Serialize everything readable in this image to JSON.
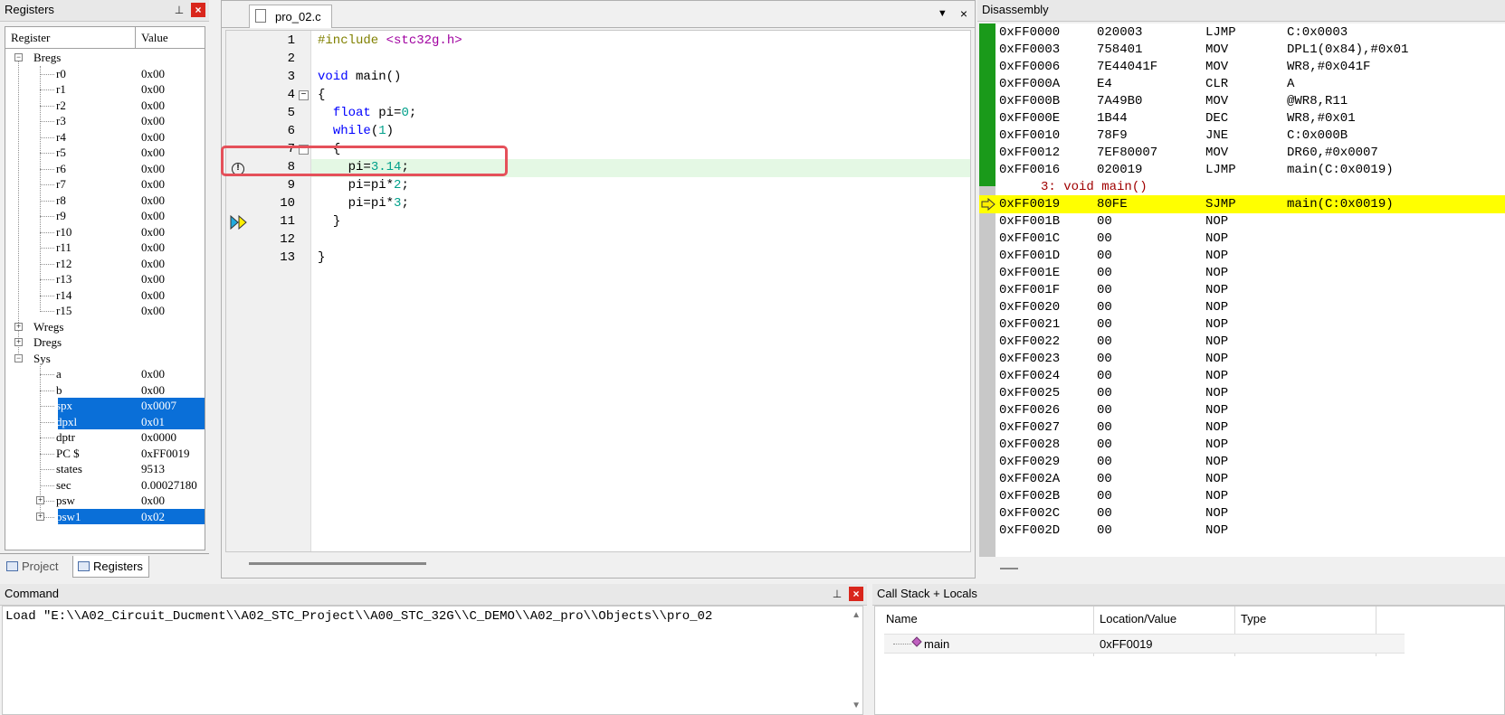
{
  "registers": {
    "title": "Registers",
    "headers": {
      "register": "Register",
      "value": "Value"
    },
    "groups": {
      "bregs": "Bregs",
      "wregs": "Wregs",
      "dregs": "Dregs",
      "sys": "Sys"
    },
    "bregs": [
      {
        "name": "r0",
        "value": "0x00"
      },
      {
        "name": "r1",
        "value": "0x00"
      },
      {
        "name": "r2",
        "value": "0x00"
      },
      {
        "name": "r3",
        "value": "0x00"
      },
      {
        "name": "r4",
        "value": "0x00"
      },
      {
        "name": "r5",
        "value": "0x00"
      },
      {
        "name": "r6",
        "value": "0x00"
      },
      {
        "name": "r7",
        "value": "0x00"
      },
      {
        "name": "r8",
        "value": "0x00"
      },
      {
        "name": "r9",
        "value": "0x00"
      },
      {
        "name": "r10",
        "value": "0x00"
      },
      {
        "name": "r11",
        "value": "0x00"
      },
      {
        "name": "r12",
        "value": "0x00"
      },
      {
        "name": "r13",
        "value": "0x00"
      },
      {
        "name": "r14",
        "value": "0x00"
      },
      {
        "name": "r15",
        "value": "0x00"
      }
    ],
    "sys": [
      {
        "name": "a",
        "value": "0x00"
      },
      {
        "name": "b",
        "value": "0x00"
      },
      {
        "name": "spx",
        "value": "0x0007"
      },
      {
        "name": "dpxl",
        "value": "0x01"
      },
      {
        "name": "dptr",
        "value": "0x0000"
      },
      {
        "name": "PC  $",
        "value": "0xFF0019"
      },
      {
        "name": "states",
        "value": "9513"
      },
      {
        "name": "sec",
        "value": "0.00027180"
      },
      {
        "name": "psw",
        "value": "0x00"
      },
      {
        "name": "psw1",
        "value": "0x02"
      }
    ],
    "tabs": {
      "project": "Project",
      "registers": "Registers"
    }
  },
  "editor": {
    "tab": "pro_02.c",
    "lines": [
      "1",
      "2",
      "3",
      "4",
      "5",
      "6",
      "7",
      "8",
      "9",
      "10",
      "11",
      "12",
      "13"
    ],
    "code": {
      "l1a": "#include ",
      "l1b": "<stc32g.h>",
      "l3a": "void",
      "l3b": " main()",
      "l4": "{",
      "l5a": "float",
      "l5b": " pi=",
      "l5c": "0",
      "l5d": ";",
      "l6a": "while",
      "l6b": "(",
      "l6c": "1",
      "l6d": ")",
      "l7": "{",
      "l8a": "pi=",
      "l8b": "3.14",
      "l8c": ";",
      "l9a": "pi=pi*",
      "l9b": "2",
      "l9c": ";",
      "l10a": "pi=pi*",
      "l10b": "3",
      "l10c": ";",
      "l11": "}",
      "l13": "}"
    },
    "breakpoint_glyph": "!"
  },
  "disassembly": {
    "title": "Disassembly",
    "rows": [
      {
        "addr": "0xFF0000",
        "op": "020003",
        "mn": "LJMP",
        "arg": "C:0x0003"
      },
      {
        "addr": "0xFF0003",
        "op": "758401",
        "mn": "MOV",
        "arg": "DPL1(0x84),#0x01"
      },
      {
        "addr": "0xFF0006",
        "op": "7E44041F",
        "mn": "MOV",
        "arg": "WR8,#0x041F"
      },
      {
        "addr": "0xFF000A",
        "op": "E4",
        "mn": "CLR",
        "arg": "A"
      },
      {
        "addr": "0xFF000B",
        "op": "7A49B0",
        "mn": "MOV",
        "arg": "@WR8,R11"
      },
      {
        "addr": "0xFF000E",
        "op": "1B44",
        "mn": "DEC",
        "arg": "WR8,#0x01"
      },
      {
        "addr": "0xFF0010",
        "op": "78F9",
        "mn": "JNE",
        "arg": "C:0x000B"
      },
      {
        "addr": "0xFF0012",
        "op": "7EF80007",
        "mn": "MOV",
        "arg": "DR60,#0x0007"
      },
      {
        "addr": "0xFF0016",
        "op": "020019",
        "mn": "LJMP",
        "arg": "main(C:0x0019)"
      }
    ],
    "source_line": "3: void main()",
    "pc_row": {
      "addr": "0xFF0019",
      "op": "80FE",
      "mn": "SJMP",
      "arg": "main(C:0x0019)"
    },
    "nop_rows": [
      {
        "addr": "0xFF001B",
        "op": "00",
        "mn": "NOP"
      },
      {
        "addr": "0xFF001C",
        "op": "00",
        "mn": "NOP"
      },
      {
        "addr": "0xFF001D",
        "op": "00",
        "mn": "NOP"
      },
      {
        "addr": "0xFF001E",
        "op": "00",
        "mn": "NOP"
      },
      {
        "addr": "0xFF001F",
        "op": "00",
        "mn": "NOP"
      },
      {
        "addr": "0xFF0020",
        "op": "00",
        "mn": "NOP"
      },
      {
        "addr": "0xFF0021",
        "op": "00",
        "mn": "NOP"
      },
      {
        "addr": "0xFF0022",
        "op": "00",
        "mn": "NOP"
      },
      {
        "addr": "0xFF0023",
        "op": "00",
        "mn": "NOP"
      },
      {
        "addr": "0xFF0024",
        "op": "00",
        "mn": "NOP"
      },
      {
        "addr": "0xFF0025",
        "op": "00",
        "mn": "NOP"
      },
      {
        "addr": "0xFF0026",
        "op": "00",
        "mn": "NOP"
      },
      {
        "addr": "0xFF0027",
        "op": "00",
        "mn": "NOP"
      },
      {
        "addr": "0xFF0028",
        "op": "00",
        "mn": "NOP"
      },
      {
        "addr": "0xFF0029",
        "op": "00",
        "mn": "NOP"
      },
      {
        "addr": "0xFF002A",
        "op": "00",
        "mn": "NOP"
      },
      {
        "addr": "0xFF002B",
        "op": "00",
        "mn": "NOP"
      },
      {
        "addr": "0xFF002C",
        "op": "00",
        "mn": "NOP"
      },
      {
        "addr": "0xFF002D",
        "op": "00",
        "mn": "NOP"
      }
    ]
  },
  "command": {
    "title": "Command",
    "text": "Load \"E:\\\\A02_Circuit_Ducment\\\\A02_STC_Project\\\\A00_STC_32G\\\\C_DEMO\\\\A02_pro\\\\Objects\\\\pro_02"
  },
  "callstack": {
    "title": "Call Stack + Locals",
    "headers": {
      "name": "Name",
      "location": "Location/Value",
      "type": "Type"
    },
    "row": {
      "name": "main",
      "location": "0xFF0019",
      "type": ""
    }
  },
  "icons": {
    "pin": "pin-icon",
    "close": "close-icon",
    "dropdown": "chevron-down-icon"
  },
  "colors": {
    "pc_highlight": "#ffff00",
    "selection": "#0a6fd8",
    "close": "#d9261c",
    "current_line": "#e4f8e4",
    "callout": "#e5505a",
    "exec_gutter": "#1a9a1a"
  },
  "ui": {
    "pin": "⊥",
    "close": "×",
    "dropdown": "▼",
    "scroll_up": "▲",
    "scroll_down": "▼",
    "plus": "+",
    "minus": "−"
  }
}
